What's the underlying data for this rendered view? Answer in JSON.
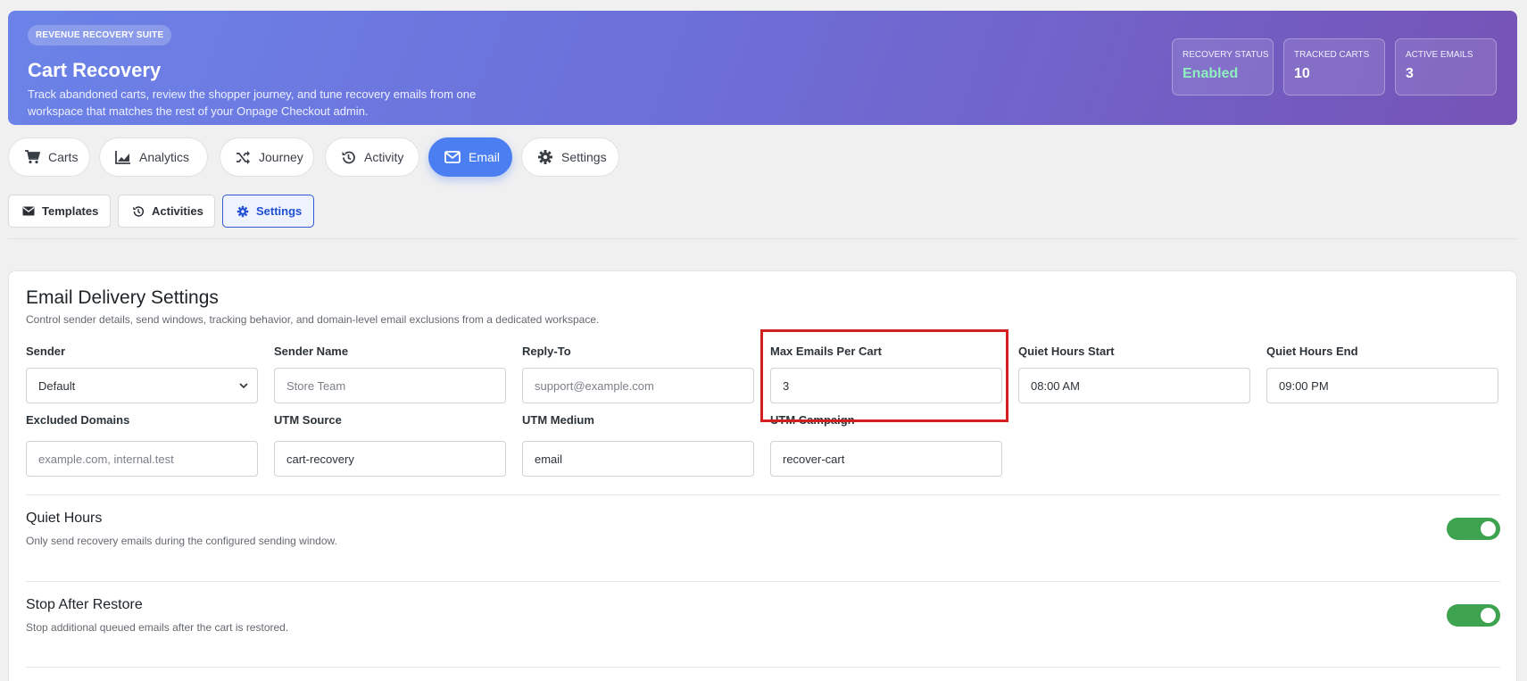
{
  "hero": {
    "pill": "REVENUE RECOVERY SUITE",
    "title": "Cart Recovery",
    "description": "Track abandoned carts, review the shopper journey, and tune recovery emails from one workspace that matches the rest of your Onpage Checkout admin.",
    "stats": [
      {
        "label": "RECOVERY STATUS",
        "value": "Enabled",
        "color": "#8ef0c0"
      },
      {
        "label": "TRACKED CARTS",
        "value": "10"
      },
      {
        "label": "ACTIVE EMAILS",
        "value": "3"
      }
    ]
  },
  "primary_tabs": [
    {
      "label": "Carts",
      "icon": "cart-icon"
    },
    {
      "label": "Analytics",
      "icon": "area-chart-icon"
    },
    {
      "label": "Journey",
      "icon": "shuffle-icon"
    },
    {
      "label": "Activity",
      "icon": "history-icon"
    },
    {
      "label": "Email",
      "icon": "envelope-icon",
      "active": true
    },
    {
      "label": "Settings",
      "icon": "gear-icon"
    }
  ],
  "sub_tabs": [
    {
      "label": "Templates",
      "icon": "envelope-icon"
    },
    {
      "label": "Activities",
      "icon": "history-icon"
    },
    {
      "label": "Settings",
      "icon": "gear-icon",
      "active": true
    }
  ],
  "card": {
    "title": "Email Delivery Settings",
    "subtitle": "Control sender details, send windows, tracking behavior, and domain-level email exclusions from a dedicated workspace."
  },
  "fields": {
    "sender": {
      "label": "Sender",
      "value": "Default"
    },
    "sender_name": {
      "label": "Sender Name",
      "placeholder": "Store Team"
    },
    "reply_to": {
      "label": "Reply-To",
      "placeholder": "support@example.com"
    },
    "max_emails": {
      "label": "Max Emails Per Cart",
      "value": "3"
    },
    "quiet_start": {
      "label": "Quiet Hours Start",
      "value": "08:00 AM"
    },
    "quiet_end": {
      "label": "Quiet Hours End",
      "value": "09:00 PM"
    },
    "excluded_domains": {
      "label": "Excluded Domains",
      "placeholder": "example.com, internal.test"
    },
    "utm_source": {
      "label": "UTM Source",
      "value": "cart-recovery"
    },
    "utm_medium": {
      "label": "UTM Medium",
      "value": "email"
    },
    "utm_campaign": {
      "label": "UTM Campaign",
      "value": "recover-cart"
    }
  },
  "options": {
    "quiet_hours": {
      "title": "Quiet Hours",
      "desc": "Only send recovery emails during the configured sending window.",
      "enabled": true
    },
    "stop_after_restore": {
      "title": "Stop After Restore",
      "desc": "Stop additional queued emails after the cart is restored.",
      "enabled": true
    }
  },
  "colors": {
    "accent": "#4b7ef0",
    "toggle_on": "#3ea34e",
    "highlight": "#d41f1f"
  }
}
